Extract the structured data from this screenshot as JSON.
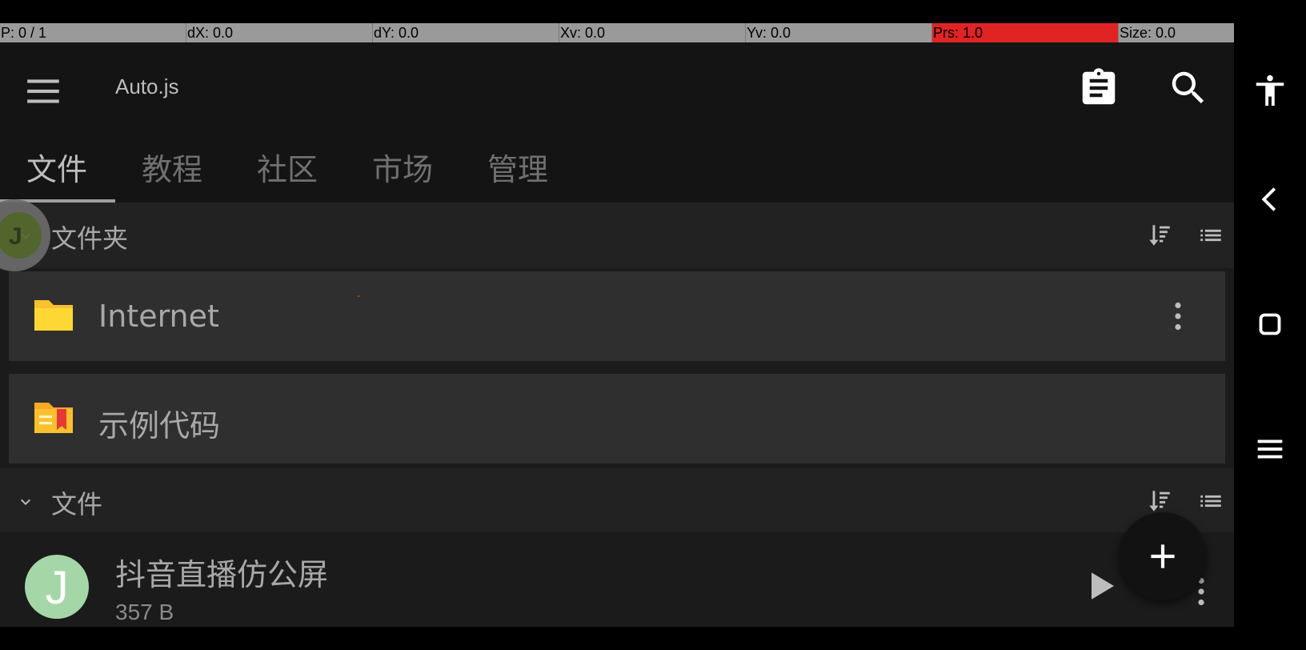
{
  "pointer_overlay": {
    "fields": [
      {
        "text": "P: 0 / 1"
      },
      {
        "text": "dX: 0.0"
      },
      {
        "text": "dY: 0.0"
      },
      {
        "text": "Xv: 0.0"
      },
      {
        "text": "Yv: 0.0"
      },
      {
        "text": "Prs: 1.0"
      },
      {
        "text": "Size: 0.0"
      }
    ]
  },
  "toolbar": {
    "title": "Auto.js",
    "menu_icon": "menu-icon",
    "clipboard_icon": "clipboard-icon",
    "search_icon": "search-icon"
  },
  "tabs": [
    {
      "label": "文件",
      "active": true
    },
    {
      "label": "教程"
    },
    {
      "label": "社区"
    },
    {
      "label": "市场"
    },
    {
      "label": "管理"
    }
  ],
  "folders_section": {
    "label": "文件夹",
    "items": [
      {
        "name": "Internet",
        "icon": "folder-icon"
      },
      {
        "name": "示例代码",
        "icon": "sample-folder-icon"
      }
    ]
  },
  "files_section": {
    "label": "文件",
    "items": [
      {
        "avatar_letter": "J",
        "name": "抖音直播仿公屏",
        "size": "357 B"
      }
    ]
  },
  "fab": {
    "icon": "plus-icon"
  },
  "colors": {
    "accent_folder": "#fbc02d",
    "avatar": "#a5d6a7",
    "prs_highlight": "#e02424"
  }
}
